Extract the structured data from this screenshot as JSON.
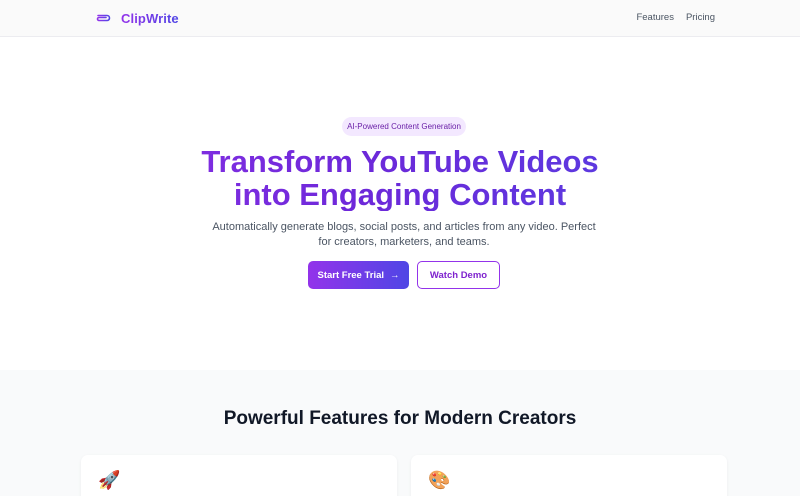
{
  "header": {
    "brand": "ClipWrite",
    "logo_icon": "paperclip-icon",
    "nav": [
      {
        "label": "Features"
      },
      {
        "label": "Pricing"
      }
    ]
  },
  "hero": {
    "badge": "AI-Powered Content Generation",
    "headline_line1": "Transform YouTube Videos",
    "headline_line2": "into Engaging Content",
    "subtext": "Automatically generate blogs, social posts, and articles from any video. Perfect for creators, marketers, and teams.",
    "primary_button": "Start Free Trial",
    "primary_button_arrow": "→",
    "secondary_button": "Watch Demo"
  },
  "features": {
    "title": "Powerful Features for Modern Creators",
    "cards": [
      {
        "icon": "rocket-icon",
        "glyph": "🚀"
      },
      {
        "icon": "palette-icon",
        "glyph": "🎨"
      }
    ]
  },
  "colors": {
    "brand_purple": "#9333ea",
    "brand_indigo": "#4f46e5",
    "badge_bg": "#f3e8ff",
    "badge_text": "#6b21a8",
    "features_bg": "#f9fafb"
  }
}
